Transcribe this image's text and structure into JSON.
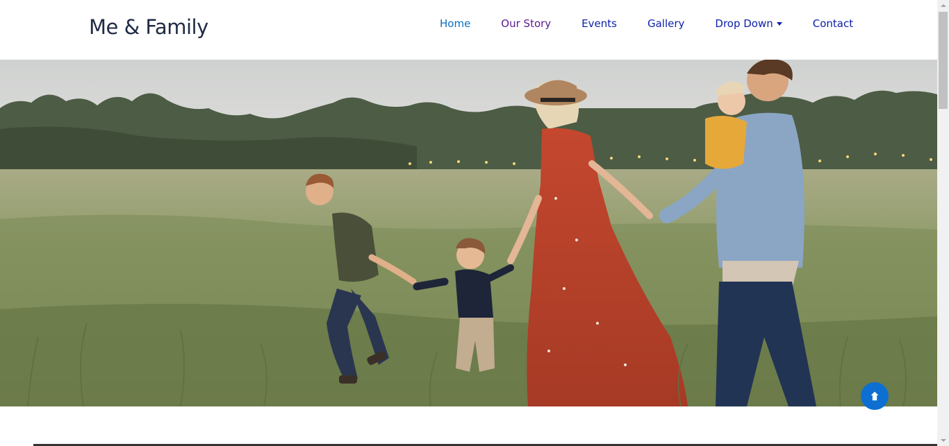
{
  "header": {
    "brand": "Me & Family",
    "nav": [
      {
        "label": "Home",
        "color": "#0a6ebd",
        "active": true
      },
      {
        "label": "Our Story",
        "color": "#5b1a8c"
      },
      {
        "label": "Events",
        "color": "#0b1fa8"
      },
      {
        "label": "Gallery",
        "color": "#0b1fa8"
      },
      {
        "label": "Drop Down",
        "color": "#0b1fa8",
        "dropdown": true
      },
      {
        "label": "Contact",
        "color": "#0b1fa8"
      }
    ]
  },
  "hero": {
    "image": "family-walking-in-field-photo"
  },
  "back_to_top": {
    "icon": "arrow-up-icon",
    "color": "#0d6fd1"
  }
}
